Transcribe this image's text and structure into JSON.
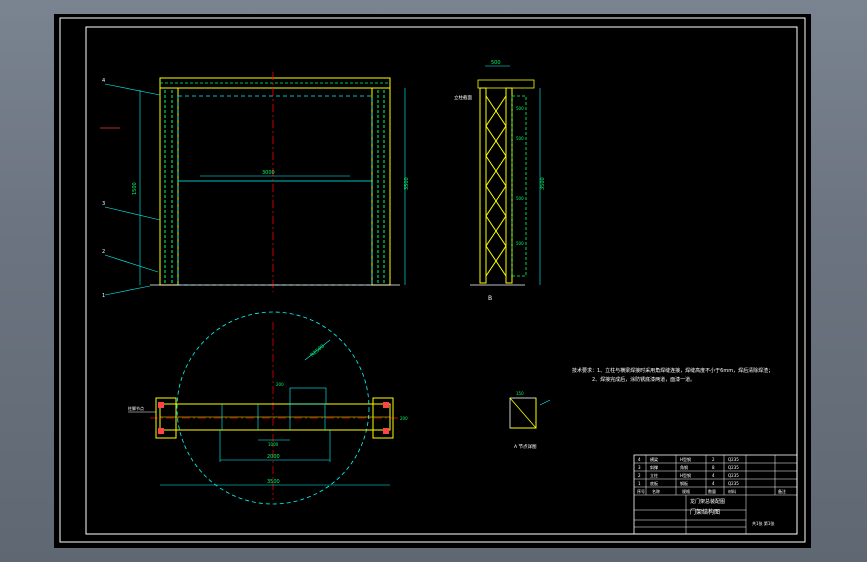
{
  "notes": {
    "line1": "技术要求：1、立柱与横梁焊接时采用角焊缝连接，焊缝高度不小于6mm，焊后清除焊渣；",
    "line2": "2、焊接完成后，涂防锈底漆两道，面漆一道。"
  },
  "front_view": {
    "width_dim": "3000",
    "height_dim": "3500",
    "left_dim": "1500"
  },
  "side_view": {
    "top_dim": "500",
    "left_label": "立柱截面",
    "panel_dims": [
      "500",
      "500",
      "500",
      "500"
    ],
    "height_dim": "3500",
    "caption": "B"
  },
  "plan_view": {
    "left_label": "柱脚节点",
    "dim_inner": "2000",
    "dim_total": "3500",
    "dim_center": "1000",
    "dim_top": "200",
    "dim_side": "200",
    "radius": "R2500"
  },
  "detail_view": {
    "top_dim": "150",
    "caption": "A 节点详图"
  },
  "leaders": [
    "4",
    "3",
    "2",
    "1"
  ],
  "title_block": {
    "drawing_title": "门架结构图",
    "project": "龙门架总装配图",
    "sheet": "共1张 第1张",
    "bom_rows": [
      {
        "no": "4",
        "name": "横梁",
        "spec": "H型钢",
        "qty": "2",
        "mat": "Q235"
      },
      {
        "no": "3",
        "name": "斜撑",
        "spec": "角钢",
        "qty": "8",
        "mat": "Q235"
      },
      {
        "no": "2",
        "name": "立柱",
        "spec": "H型钢",
        "qty": "4",
        "mat": "Q235"
      },
      {
        "no": "1",
        "name": "底板",
        "spec": "钢板",
        "qty": "4",
        "mat": "Q235"
      }
    ],
    "header": [
      "序号",
      "名称",
      "规格",
      "数量",
      "材料",
      "备注"
    ]
  }
}
